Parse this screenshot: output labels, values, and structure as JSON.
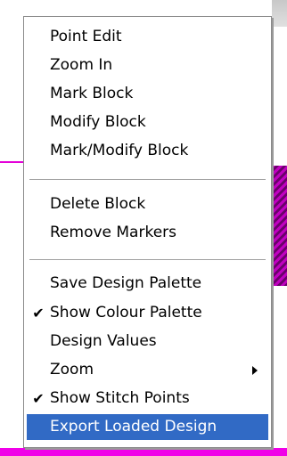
{
  "menu": {
    "items": [
      {
        "label": "Point Edit",
        "checked": false
      },
      {
        "label": "Zoom In",
        "checked": false
      },
      {
        "label": "Mark Block",
        "checked": false
      },
      {
        "label": "Modify Block",
        "checked": false
      },
      {
        "label": "Mark/Modify Block",
        "checked": false
      },
      {
        "label": "Delete Block",
        "checked": false
      },
      {
        "label": "Remove Markers",
        "checked": false
      },
      {
        "label": "Save Design Palette",
        "checked": false
      },
      {
        "label": "Show Colour Palette",
        "checked": true
      },
      {
        "label": "Design Values",
        "checked": false
      },
      {
        "label": "Zoom",
        "checked": false,
        "submenu": true
      },
      {
        "label": "Show Stitch Points",
        "checked": true
      },
      {
        "label": "Export Loaded Design",
        "checked": false,
        "highlighted": true
      }
    ],
    "check_glyph": "✔",
    "colors": {
      "highlight": "#316ac5",
      "background_accent": "#f000e8"
    }
  }
}
